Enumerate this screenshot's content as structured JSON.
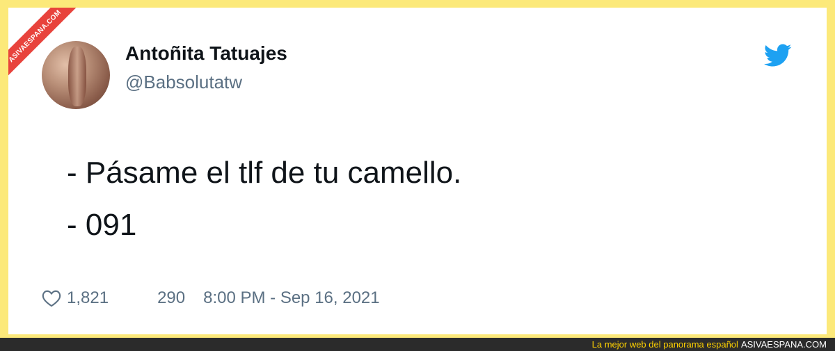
{
  "watermark": {
    "ribbon_text": "ASIVAESPANA.COM",
    "tagline": "La mejor web del panorama español",
    "site": "ASIVAESPANA.COM"
  },
  "tweet": {
    "display_name": "Antoñita Tatuajes",
    "handle": "@Babsolutatw",
    "lines": [
      "- Pásame el tlf de tu camello.",
      "- 091"
    ],
    "likes": "1,821",
    "retweets": "290",
    "timestamp": "8:00 PM - Sep 16, 2021"
  },
  "icons": {
    "brand": "twitter-bird-icon",
    "like": "heart-icon"
  },
  "colors": {
    "frame": "#fce97a",
    "twitter_blue": "#1da1f2",
    "ribbon": "#e8433c",
    "text": "#0f1419",
    "muted": "#5b7083"
  }
}
